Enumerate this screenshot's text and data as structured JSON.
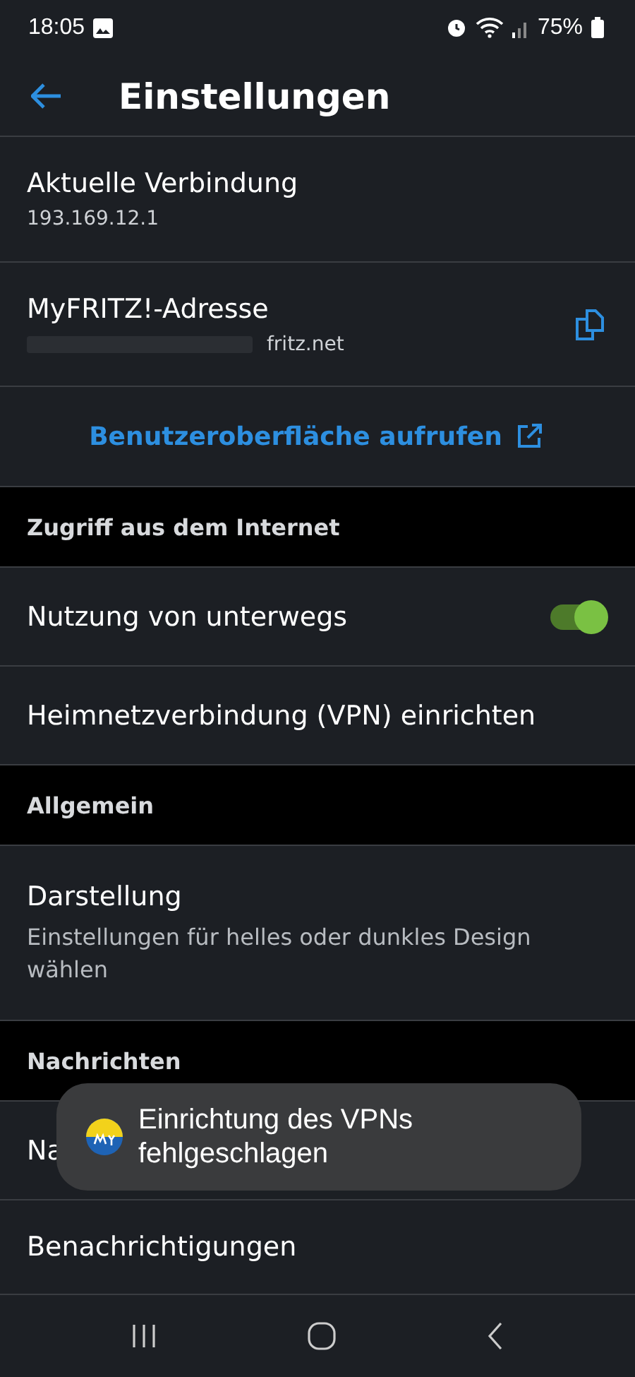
{
  "status_bar": {
    "time": "18:05",
    "battery": "75%"
  },
  "header": {
    "title": "Einstellungen"
  },
  "connection": [
    {
      "kind": "info",
      "label": "Aktuelle Verbindung",
      "value": "193.169.12.1"
    },
    {
      "kind": "copy",
      "label": "MyFRITZ!-Adresse",
      "value": "fritz.net"
    }
  ],
  "link": {
    "label": "Benutzeroberfläche aufrufen"
  },
  "sections": [
    {
      "title": "Zugriff aus dem Internet",
      "items": [
        {
          "kind": "toggle",
          "label": "Nutzung von unterwegs",
          "on": true
        },
        {
          "kind": "plain",
          "label": "Heimnetzverbindung (VPN) einrichten"
        }
      ]
    },
    {
      "title": "Allgemein",
      "items": [
        {
          "kind": "plain",
          "label": "Darstellung",
          "subtitle": "Einstellungen für helles oder dunkles Design wählen"
        }
      ]
    },
    {
      "title": "Nachrichten",
      "items": [
        {
          "kind": "plain",
          "label": "Na"
        },
        {
          "kind": "plain",
          "label": "Benachrichtigungen"
        }
      ]
    }
  ],
  "toast": {
    "message": "Einrichtung des VPNs fehlgeschlagen"
  }
}
